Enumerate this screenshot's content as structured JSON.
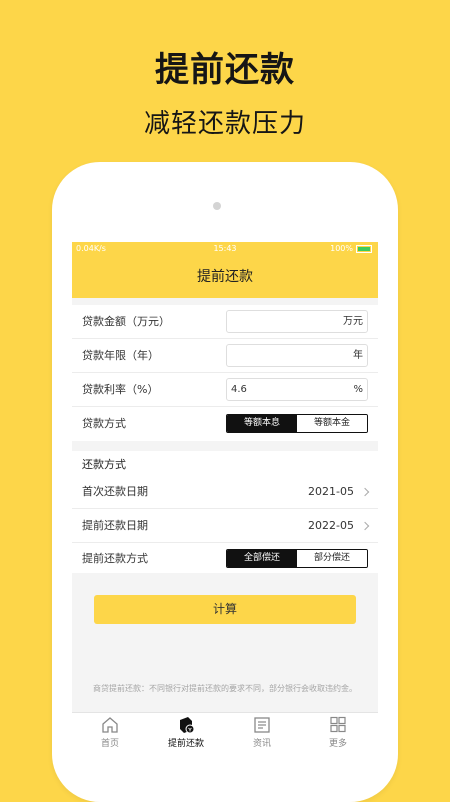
{
  "promo": {
    "headline": "提前还款",
    "subline": "减轻还款压力"
  },
  "statusbar": {
    "network": "0.04K/s",
    "time": "15:43",
    "battery": "100%"
  },
  "navbar": {
    "title": "提前还款"
  },
  "loan": {
    "amount": {
      "label": "贷款金额（万元）",
      "value": "",
      "unit": "万元"
    },
    "years": {
      "label": "贷款年限（年）",
      "value": "",
      "unit": "年"
    },
    "rate": {
      "label": "贷款利率（%）",
      "value": "4.6",
      "unit": "%"
    },
    "method": {
      "label": "贷款方式",
      "options": [
        "等额本息",
        "等额本金"
      ],
      "selected": "等额本息"
    }
  },
  "repay": {
    "section_title": "还款方式",
    "first_date": {
      "label": "首次还款日期",
      "value": "2021-05"
    },
    "prepay_date": {
      "label": "提前还款日期",
      "value": "2022-05"
    },
    "prepay_method": {
      "label": "提前还款方式",
      "options": [
        "全部偿还",
        "部分偿还"
      ],
      "selected": "全部偿还"
    }
  },
  "calculate_label": "计算",
  "note": "商贷提前还款：不同银行对提前还款的要求不同，部分银行会收取违约金。",
  "tabs": [
    {
      "label": "首页",
      "icon": "home-icon"
    },
    {
      "label": "提前还款",
      "icon": "prepay-icon",
      "active": true
    },
    {
      "label": "资讯",
      "icon": "news-icon"
    },
    {
      "label": "更多",
      "icon": "grid-icon"
    }
  ],
  "colors": {
    "accent": "#FDD649",
    "dark": "#111111"
  }
}
